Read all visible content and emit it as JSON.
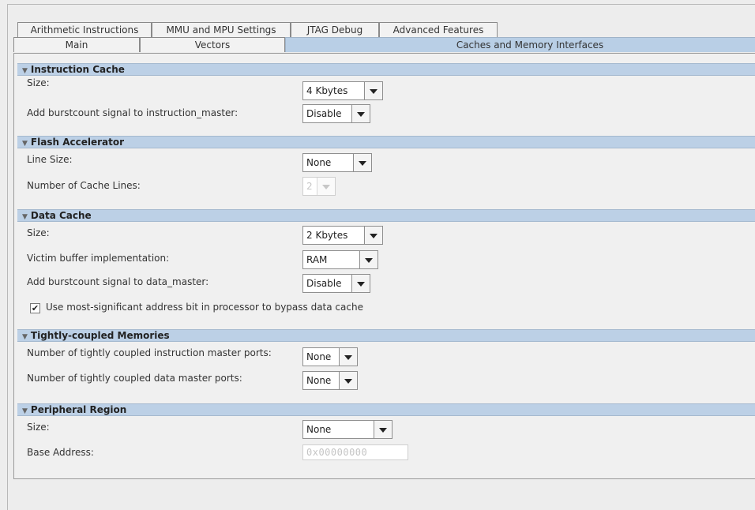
{
  "tabs_row1": [
    "Arithmetic Instructions",
    "MMU and MPU Settings",
    "JTAG Debug",
    "Advanced Features"
  ],
  "tabs_row2": [
    "Main",
    "Vectors",
    "Caches and Memory Interfaces"
  ],
  "selected_tab": "Caches and Memory Interfaces",
  "sections": {
    "instruction_cache": {
      "title": "Instruction Cache",
      "size_label": "Size:",
      "size_value": "4 Kbytes",
      "burst_label": "Add burstcount signal to instruction_master:",
      "burst_value": "Disable"
    },
    "flash_accelerator": {
      "title": "Flash Accelerator",
      "line_size_label": "Line Size:",
      "line_size_value": "None",
      "cache_lines_label": "Number of Cache Lines:",
      "cache_lines_value": "2"
    },
    "data_cache": {
      "title": "Data Cache",
      "size_label": "Size:",
      "size_value": "2 Kbytes",
      "victim_label": "Victim buffer implementation:",
      "victim_value": "RAM",
      "burst_label": "Add burstcount signal to data_master:",
      "burst_value": "Disable",
      "bypass_label": "Use most-significant address bit in processor to bypass data cache",
      "bypass_checked": true
    },
    "tcm": {
      "title": "Tightly-coupled Memories",
      "instr_label": "Number of tightly coupled instruction master ports:",
      "instr_value": "None",
      "data_label": "Number of tightly coupled data master ports:",
      "data_value": "None"
    },
    "peripheral_region": {
      "title": "Peripheral Region",
      "size_label": "Size:",
      "size_value": "None",
      "base_label": "Base Address:",
      "base_value": "0x00000000"
    }
  }
}
